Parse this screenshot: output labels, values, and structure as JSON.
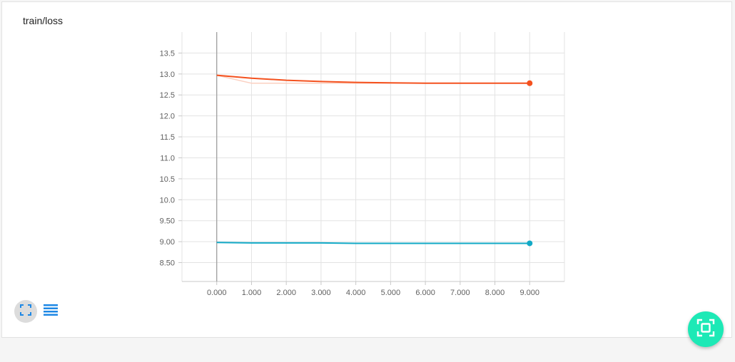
{
  "card": {
    "title": "train/loss"
  },
  "icons": {
    "expand": "fullscreen-icon",
    "data": "lines-icon",
    "fab": "fit-domain-icon"
  },
  "colors": {
    "series_orange": "#f4511e",
    "series_orange_raw": "#fbd0c1",
    "series_teal": "#12a9c6",
    "fab": "#1de9b6",
    "accent": "#1e88e5"
  },
  "chart_data": {
    "type": "line",
    "title": "train/loss",
    "xlabel": "",
    "ylabel": "",
    "xlim": [
      -1,
      10
    ],
    "ylim": [
      8.05,
      14.0
    ],
    "x_ticks": [
      "0.000",
      "1.000",
      "2.000",
      "3.000",
      "4.000",
      "5.000",
      "6.000",
      "7.000",
      "8.000",
      "9.000"
    ],
    "y_ticks": [
      "8.50",
      "9.00",
      "9.50",
      "10.0",
      "10.5",
      "11.0",
      "11.5",
      "12.0",
      "12.5",
      "13.0",
      "13.5"
    ],
    "grid": true,
    "series": [
      {
        "color": "#f4511e",
        "x": [
          0,
          1,
          2,
          3,
          4,
          5,
          6,
          7,
          8,
          9
        ],
        "y": [
          12.97,
          12.9,
          12.85,
          12.82,
          12.8,
          12.79,
          12.78,
          12.78,
          12.78,
          12.78
        ]
      },
      {
        "color": "#fbd0c1",
        "x": [
          0,
          1,
          2,
          3,
          4,
          5,
          6,
          7,
          8,
          9
        ],
        "y": [
          12.97,
          12.78,
          12.78,
          12.78,
          12.78,
          12.78,
          12.78,
          12.78,
          12.78,
          12.78
        ]
      },
      {
        "color": "#12a9c6",
        "x": [
          0,
          1,
          2,
          3,
          4,
          5,
          6,
          7,
          8,
          9
        ],
        "y": [
          8.98,
          8.97,
          8.97,
          8.97,
          8.96,
          8.96,
          8.96,
          8.96,
          8.96,
          8.96
        ]
      }
    ]
  }
}
